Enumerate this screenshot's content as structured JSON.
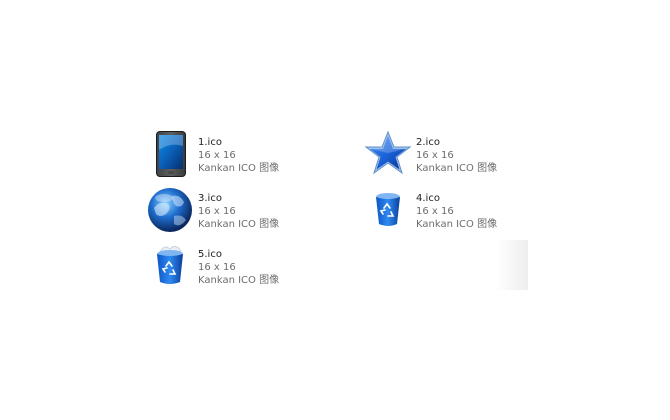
{
  "files": [
    {
      "name": "1.ico",
      "dims": "16 x 16",
      "type": "Kankan ICO 图像",
      "icon": "tablet-icon"
    },
    {
      "name": "2.ico",
      "dims": "16 x 16",
      "type": "Kankan ICO 图像",
      "icon": "star-icon"
    },
    {
      "name": "3.ico",
      "dims": "16 x 16",
      "type": "Kankan ICO 图像",
      "icon": "globe-icon"
    },
    {
      "name": "4.ico",
      "dims": "16 x 16",
      "type": "Kankan ICO 图像",
      "icon": "recycle-bin-icon"
    },
    {
      "name": "5.ico",
      "dims": "16 x 16",
      "type": "Kankan ICO 图像",
      "icon": "recycle-bin-full-icon"
    }
  ],
  "colors": {
    "icon_blue": "#1a5fd6",
    "icon_dark_blue": "#0a2f8a",
    "text_primary": "#1e1e1e",
    "text_secondary": "#6d6d6d"
  }
}
